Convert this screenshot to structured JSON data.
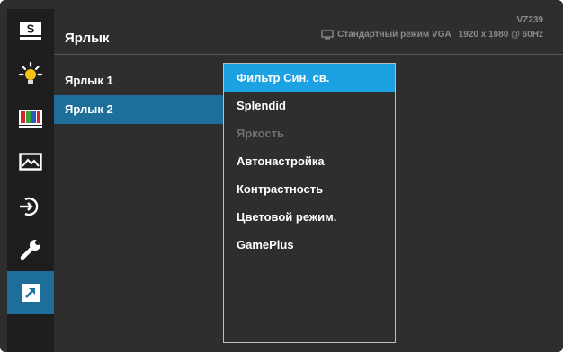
{
  "header": {
    "title": "Ярлык",
    "model": "VZ239",
    "mode": "Стандартный режим VGA",
    "resolution": "1920 x 1080 @ 60Hz"
  },
  "sidebar_icons": [
    {
      "icon": "splendid-s-icon",
      "selected": false
    },
    {
      "icon": "brightness-sun-icon",
      "selected": false
    },
    {
      "icon": "color-bars-icon",
      "selected": false
    },
    {
      "icon": "image-landscape-icon",
      "selected": false
    },
    {
      "icon": "input-select-icon",
      "selected": false
    },
    {
      "icon": "wrench-settings-icon",
      "selected": false
    },
    {
      "icon": "shortcut-arrow-icon",
      "selected": true
    }
  ],
  "shortcut_list": [
    {
      "label": "Ярлык 1",
      "selected": false
    },
    {
      "label": "Ярлык 2",
      "selected": true
    }
  ],
  "function_list": [
    {
      "label": "Фильтр Син. св.",
      "state": "selected"
    },
    {
      "label": "Splendid",
      "state": "normal"
    },
    {
      "label": "Яркость",
      "state": "disabled"
    },
    {
      "label": "Автонастройка",
      "state": "normal"
    },
    {
      "label": "Контрастность",
      "state": "normal"
    },
    {
      "label": "Цветовой режим.",
      "state": "normal"
    },
    {
      "label": "GamePlus",
      "state": "normal"
    }
  ],
  "colors": {
    "background": "#2e2e2e",
    "icon_bar": "#1e1e1e",
    "accent_selected": "#1d6f99",
    "highlight": "#1ca1e2",
    "disabled_text": "#6f6f6f"
  }
}
